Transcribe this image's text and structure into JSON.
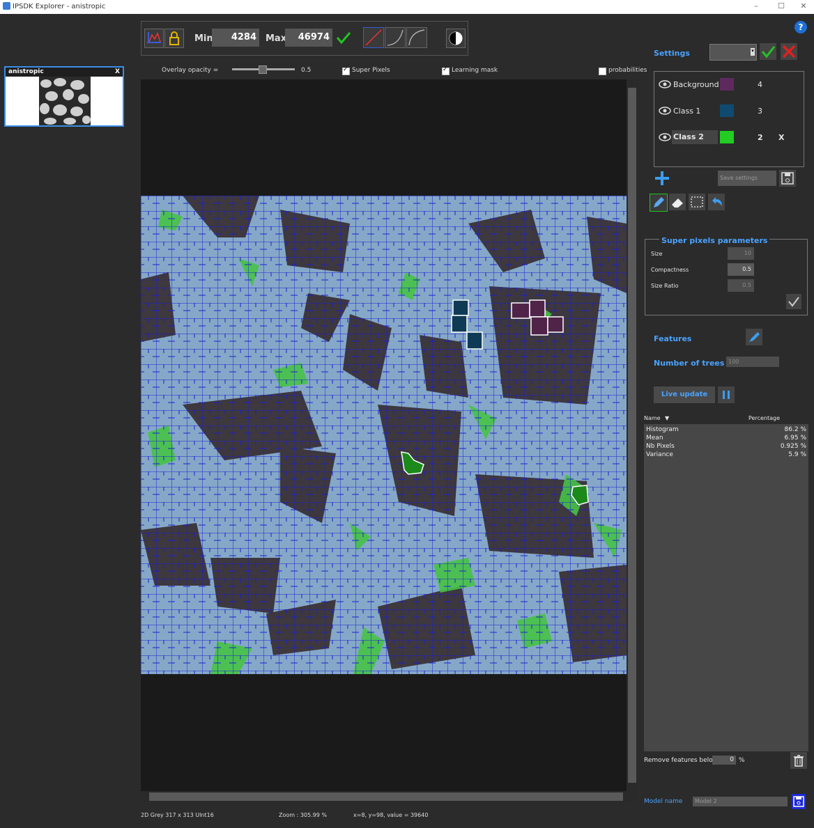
{
  "window": {
    "title": "IPSDK Explorer - anistropic",
    "controls": [
      "–",
      "☐",
      "✕"
    ]
  },
  "toolbar": {
    "min_label": "Min",
    "min_value": "4284",
    "max_label": "Max",
    "max_value": "46974"
  },
  "overlay": {
    "opacity_label": "Overlay opacity =",
    "opacity_value": "0.5",
    "super_pixels_label": "Super Pixels",
    "learning_mask_label": "Learning mask",
    "probabilities_label": "probabilities"
  },
  "thumbnail": {
    "name": "anistropic",
    "close": "X"
  },
  "settings": {
    "label": "Settings",
    "help": "?"
  },
  "classes": [
    {
      "name": "Background",
      "count": "4",
      "color": "#5e2a5e"
    },
    {
      "name": "Class 1",
      "count": "3",
      "color": "#0f4a70"
    },
    {
      "name": "Class 2",
      "count": "2",
      "color": "#22cc22",
      "remove": "X"
    }
  ],
  "save_settings_label": "Save settings",
  "superpixels": {
    "title": "Super pixels parameters",
    "size_label": "Size",
    "size_value": "10",
    "compactness_label": "Compactness",
    "compactness_value": "0.5",
    "size_ratio_label": "Size Ratio",
    "size_ratio_value": "0.5"
  },
  "features_label": "Features",
  "trees": {
    "label": "Number of trees",
    "value": "100"
  },
  "live_update_label": "Live update",
  "feature_table": {
    "col_name": "Name",
    "col_percentage": "Percentage",
    "rows": [
      {
        "name": "Histogram",
        "pct": "86.2 %"
      },
      {
        "name": "Mean",
        "pct": "6.95 %"
      },
      {
        "name": "Nb Pixels",
        "pct": "0.925 %"
      },
      {
        "name": "Variance",
        "pct": "5.9 %"
      }
    ]
  },
  "remove_features": {
    "label": "Remove features below",
    "value": "0",
    "unit": "%"
  },
  "model": {
    "label": "Model name",
    "value": "Model 2"
  },
  "status": {
    "image_info": "2D Grey 317 x 313 UInt16",
    "zoom": "Zoom : 305.99 %",
    "cursor": "x=8, y=98, value = 39640"
  }
}
